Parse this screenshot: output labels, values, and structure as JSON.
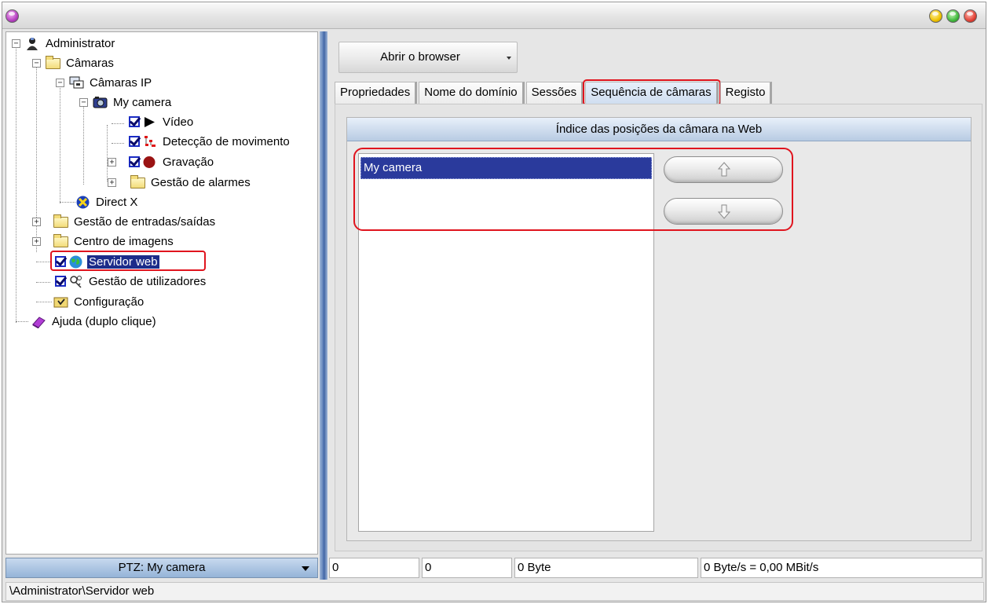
{
  "tree": {
    "items": [
      {
        "label": "Administrator"
      },
      {
        "label": "Câmaras"
      },
      {
        "label": "Câmaras IP"
      },
      {
        "label": "My camera"
      },
      {
        "label": "Vídeo"
      },
      {
        "label": "Detecção de movimento"
      },
      {
        "label": "Gravação"
      },
      {
        "label": "Gestão de alarmes"
      },
      {
        "label": "Direct X"
      },
      {
        "label": "Gestão de entradas/saídas"
      },
      {
        "label": "Centro de imagens"
      },
      {
        "label": "Servidor web"
      },
      {
        "label": "Gestão de utilizadores"
      },
      {
        "label": "Configuração"
      },
      {
        "label": "Ajuda (duplo clique)"
      }
    ]
  },
  "ptz": {
    "label": "PTZ: My camera"
  },
  "statusbar": {
    "path": "\\Administrator\\Servidor web"
  },
  "toolbar": {
    "browser_label": "Abrir o browser"
  },
  "tabs": [
    {
      "label": "Propriedades"
    },
    {
      "label": "Nome do domínio"
    },
    {
      "label": "Sessões"
    },
    {
      "label": "Sequência de câmaras"
    },
    {
      "label": "Registo"
    }
  ],
  "panel": {
    "header": "Índice das posições da câmara na Web",
    "list": [
      {
        "label": "My camera"
      }
    ]
  },
  "stats": {
    "field1": "0",
    "field2": "0",
    "bytes": "0 Byte",
    "rate": "0 Byte/s = 0,00 MBit/s"
  },
  "colors": {
    "selection": "#1c2c8a",
    "highlight_box": "#e0141e",
    "splitter": "#4a6dab"
  },
  "icons": [
    "app-orb-icon",
    "minimize-icon",
    "maximize-icon",
    "close-icon",
    "arrow-up-icon",
    "arrow-down-icon"
  ]
}
